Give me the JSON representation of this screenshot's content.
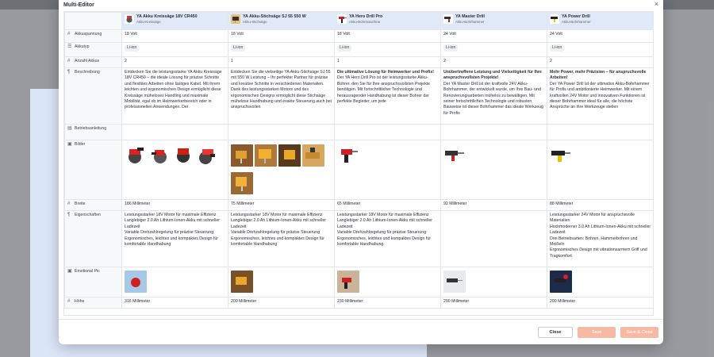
{
  "modal": {
    "title": "Multi-Editor",
    "close_symbol": "×"
  },
  "products": [
    {
      "name": "YA Akku Kreissäge 18V CR450",
      "sub": "Akku-Kreissäge"
    },
    {
      "name": "YA Akku-Stichsäge SJ 55 550 W",
      "sub": "Akku-Stichsäge"
    },
    {
      "name": "YA Hero Drill Pro",
      "sub": "Akku-Bohrmaschine"
    },
    {
      "name": "YA Master Drill",
      "sub": "Akku-Bohrhammer"
    },
    {
      "name": "YA Power Drill",
      "sub": "Akku-Bohrhammer"
    }
  ],
  "rows": {
    "spannung": {
      "label": "Akkuspannung",
      "values": [
        "18 Volt",
        "18 Volt",
        "18 Volt",
        "24 Volt",
        "24 Volt"
      ]
    },
    "akkutyp": {
      "label": "Akkutyp",
      "values": [
        "Li-ion",
        "Li-ion",
        "Li-ion",
        "Li-ion",
        "Li-ion"
      ]
    },
    "anzahl": {
      "label": "Anzahl Akkus",
      "values": [
        "2",
        "1",
        "1",
        "2",
        "2"
      ]
    },
    "beschreibung": {
      "label": "Beschreibung",
      "values": [
        {
          "bold": "",
          "text": "Entdecken Sie die leistungsstarke YA Akku Kreissäge 18V CR450 – die ideale Lösung für präzise Schnitte und flexibles Arbeiten ohne lästiges Kabel. Mit ihrem leichten und ergonomischen Design ermöglicht diese Kreissäge müheloses Handling und maximale Mobilität, egal ob im Heimwerkerbereich oder in professionellen Anwendungen. Der"
        },
        {
          "bold": "",
          "text": "Entdecken Sie die vielseitige YA Akku-Stichsäge SJ 55 mit 550 W Leistung – Ihr perfekter Partner für präzise und kreative Schnitte in verschiedenen Materialien. Dank des leistungsstarken Motors und des ergonomischen Designs ermöglicht diese Stichsäge mühelose Handhabung und exakte Steuerung auch bei anspruchsvollen"
        },
        {
          "bold": "Die ultimative Lösung für Heimwerker und Profis!",
          "text": "Der YA Hero Drill Pro ist der leistungsstarke Akku-Bohrer, den Sie für Ihre anspruchsvollsten Projekte benötigen. Mit fortschrittlicher Technologie und herausragender Handhabung ist dieser Bohrer der perfekte Begleiter, um jede"
        },
        {
          "bold": "Unübertroffene Leistung und Vielseitigkeit für Ihre anspruchsvollsten Projekte!",
          "text": "Der YA Master Drill ist der kraftvolle 24V Akku-Bohrhammer, der entwickelt wurde, um Ihre Bau- und Renovierungsarbeiten mühelos zu bewältigen. Mit seiner fortschrittlichen Technologie und robusten Bauweise ist dieser Bohrhammer das ideale Werkzeug für Profis"
        },
        {
          "bold": "Mehr Power, mehr Präzision – für anspruchsvolle Arbeiten!",
          "text": "Der YA Power Drill ist der ultimative Akku-Bohrhammer für Profis und ambitionierte Heimwerker. Mit einem kraftvollen 24V Motor und innovativen Funktionen ist dieser Bohrhammer ideal für alle, die höchste Ansprüche an ihre Werkzeuge stellen"
        }
      ]
    },
    "anleitung": {
      "label": "Betriebsanleitung"
    },
    "bilder": {
      "label": "Bilder"
    },
    "breite": {
      "label": "Breite",
      "values": [
        "186 Millimeter",
        "75 Millimeter",
        "65 Millimeter",
        "92 Millimeter",
        "88 Millimeter"
      ]
    },
    "eigenschaften": {
      "label": "Eigenschaften",
      "values": [
        [
          "Leistungsstarker 18V Motor für maximale Effizienz",
          "Langlebiger 2.0 Ah Lithium-Ionen-Akku mit schneller Ladezeit",
          "Variable Drehzahlregelung für präzise Steuerung",
          "Ergonomisches, leichtes und kompaktes Design für komfortable Handhabung"
        ],
        [
          "Leistungsstarker 18V Motor für maximale Effizienz",
          "Langlebiger 2.0 Ah Lithium-Ionen-Akku mit schneller Ladezeit",
          "Variable Drehzahlregelung für präzise Steuerung",
          "Ergonomisches, leichtes und kompaktes Design für komfortable Handhabung"
        ],
        [
          "Leistungsstarker 18V Motor für maximale Effizienz",
          "Langlebiger 2.0 Ah Lithium-Ionen-Akku mit schneller Ladezeit",
          "Variable Drehzahlregelung für präzise Steuerung",
          "Ergonomisches, leichtes und kompaktes Design für komfortable Handhabung"
        ],
        [],
        [
          "Leistungsstarker 24V Motor für anspruchsvolle Materialien",
          "Hochmoderner 3.0 Ah Lithium-Ionen-Akku mit schneller Ladezeit",
          "Drei Betriebsarten: Bohren, Hammerbohren und Meißeln",
          "Ergonomisches Design mit vibrationsarmem Griff und Tragkomfort"
        ]
      ]
    },
    "emotional": {
      "label": "Emotional Pic"
    },
    "hoehe": {
      "label": "Höhe",
      "values": [
        "316 Millimeter",
        "200 Millimeter",
        "230 Millimeter",
        "290 Millimeter",
        "290 Millimeter"
      ]
    }
  },
  "buttons": {
    "close": "Close",
    "save": "Save",
    "save_close": "Save & Close"
  },
  "colors": {
    "accent": "#f6b9a5",
    "header_bg": "#dfe9f7"
  }
}
